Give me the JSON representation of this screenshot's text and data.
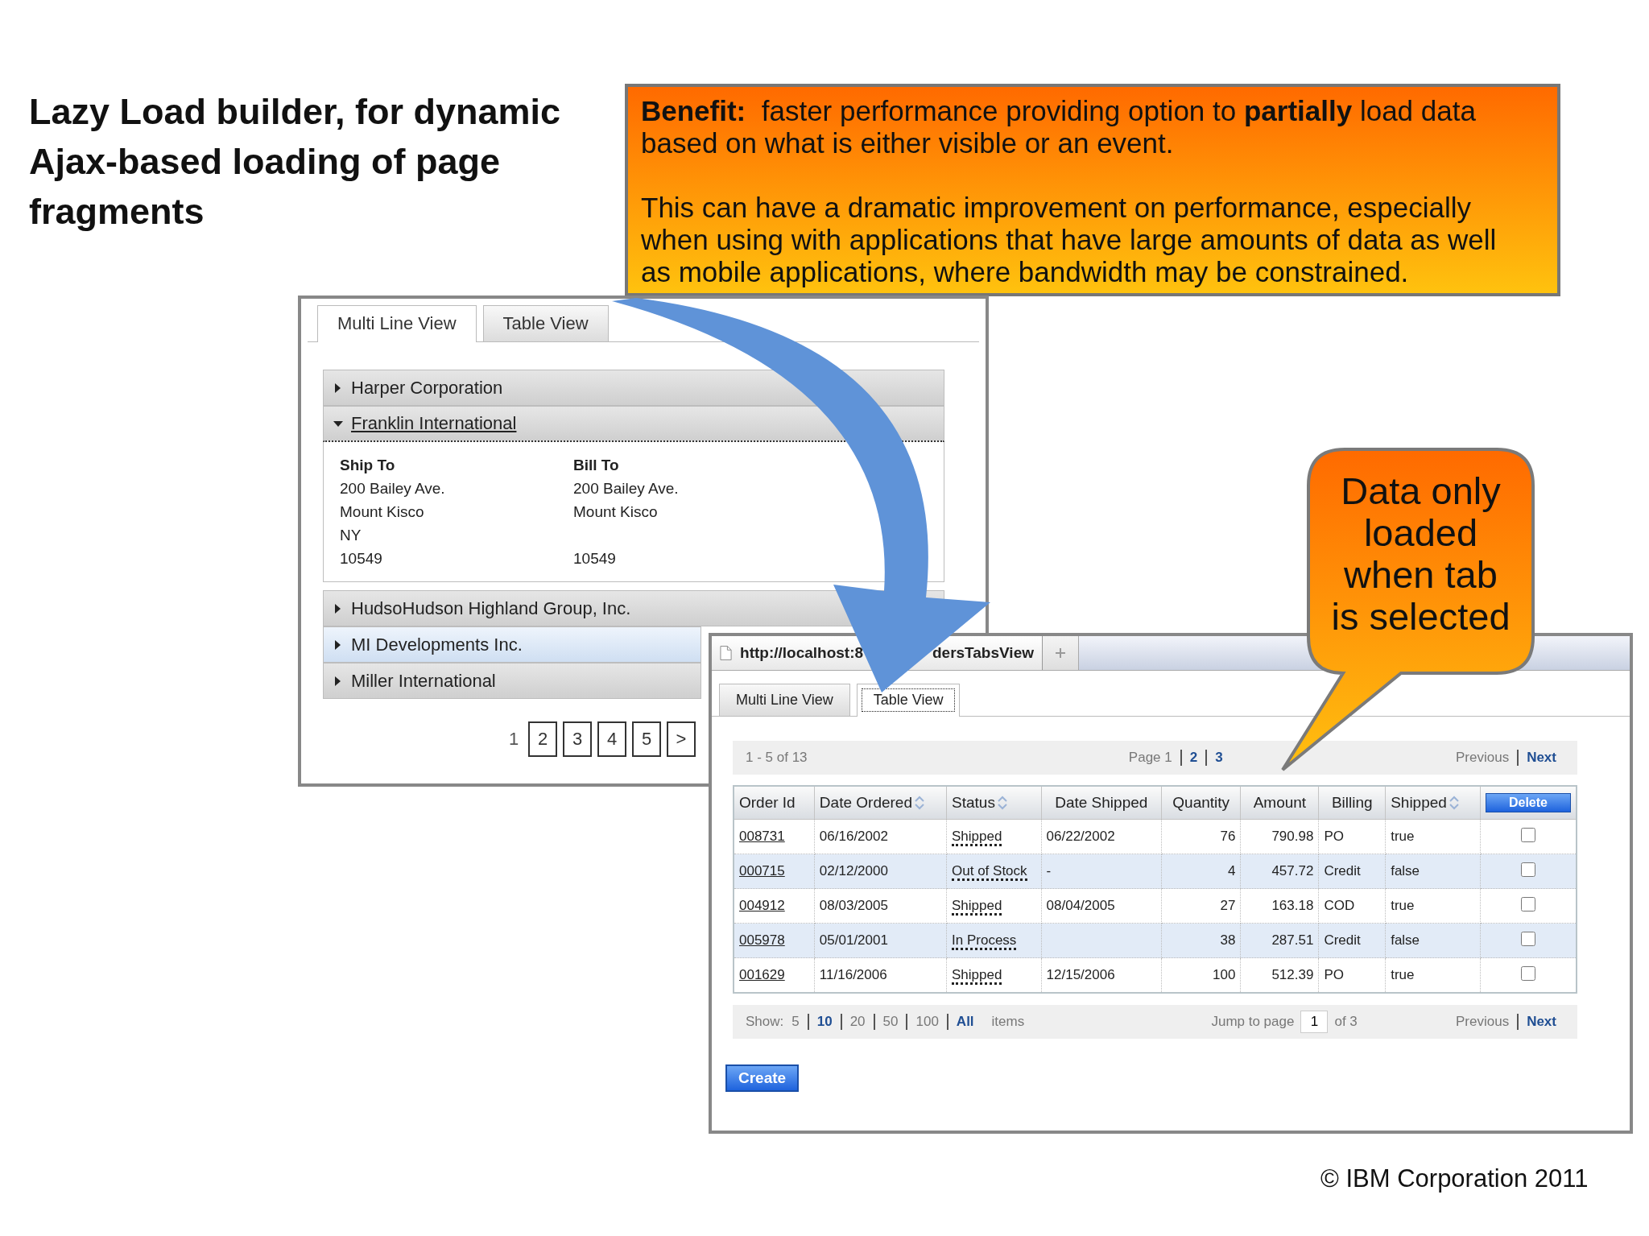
{
  "slide_title": "Lazy Load builder, for dynamic Ajax-based loading of page fragments",
  "benefit_box": {
    "paragraphs": [
      "**Benefit:**  faster performance providing option to **partially** load data based on what is either visible or an event.",
      "This can have a dramatic improvement on performance, especially when using with applications that have large amounts of data as well as mobile applications, where bandwidth may be constrained."
    ]
  },
  "multi_line_window": {
    "tabs": [
      {
        "label": "Multi Line View",
        "selected": true
      },
      {
        "label": "Table View",
        "selected": false
      }
    ],
    "accordion": [
      {
        "title": "Harper Corporation",
        "expanded": false,
        "hovered": false
      },
      {
        "title": "Franklin International",
        "expanded": true,
        "hovered": false,
        "details": {
          "headings": [
            "Ship To",
            "Bill To"
          ],
          "rows": [
            {
              "ship": "200 Bailey Ave.",
              "bill": "200 Bailey Ave."
            },
            {
              "ship": "Mount Kisco",
              "bill": "Mount Kisco"
            },
            {
              "ship": "NY"
            },
            {
              "ship": "10549",
              "bill": "10549"
            }
          ]
        }
      },
      {
        "title": "HudsoHudson Highland Group, Inc.",
        "expanded": false,
        "hovered": false
      },
      {
        "title": "MI Developments Inc.",
        "expanded": false,
        "hovered": true
      },
      {
        "title": "Miller International",
        "expanded": false,
        "hovered": false
      }
    ],
    "pagination": [
      {
        "label": "1",
        "selected": true
      },
      {
        "label": "2",
        "selected": false
      },
      {
        "label": "3",
        "selected": false
      },
      {
        "label": "4",
        "selected": false
      },
      {
        "label": "5",
        "selected": false
      },
      {
        "label": ">",
        "selected": false
      }
    ]
  },
  "table_window": {
    "browser_tab": {
      "url_start": "http://localhost:8",
      "url_end": "dersTabsView"
    },
    "tabs": [
      {
        "label": "Multi Line View",
        "selected": false
      },
      {
        "label": "Table View",
        "selected": true
      }
    ],
    "top_pager": {
      "range": "1 - 5 of 13",
      "pages": [
        {
          "label": "Page 1",
          "enabled": false
        },
        {
          "label": "2",
          "enabled": true
        },
        {
          "label": "3",
          "enabled": true
        }
      ],
      "nav": [
        {
          "label": "Previous",
          "enabled": false
        },
        {
          "label": "Next",
          "enabled": true
        }
      ]
    },
    "table": {
      "columns": [
        {
          "label": "Order Id",
          "sortable": false
        },
        {
          "label": "Date Ordered",
          "sortable": true
        },
        {
          "label": "Status",
          "sortable": true
        },
        {
          "label": "Date Shipped",
          "sortable": false
        },
        {
          "label": "Quantity",
          "sortable": false
        },
        {
          "label": "Amount",
          "sortable": false
        },
        {
          "label": "Billing",
          "sortable": false
        },
        {
          "label": "Shipped",
          "sortable": true
        }
      ],
      "delete_label": "Delete",
      "rows": [
        {
          "order_id": "008731",
          "date_ordered": "06/16/2002",
          "status": "Shipped",
          "date_shipped": "06/22/2002",
          "quantity": "76",
          "amount": "790.98",
          "billing": "PO",
          "shipped": "true",
          "checked": false
        },
        {
          "order_id": "000715",
          "date_ordered": "02/12/2000",
          "status": "Out of Stock",
          "date_shipped": "-",
          "quantity": "4",
          "amount": "457.72",
          "billing": "Credit",
          "shipped": "false",
          "checked": false
        },
        {
          "order_id": "004912",
          "date_ordered": "08/03/2005",
          "status": "Shipped",
          "date_shipped": "08/04/2005",
          "quantity": "27",
          "amount": "163.18",
          "billing": "COD",
          "shipped": "true",
          "checked": false
        },
        {
          "order_id": "005978",
          "date_ordered": "05/01/2001",
          "status": "In Process",
          "quantity": "38",
          "amount": "287.51",
          "billing": "Credit",
          "shipped": "false",
          "checked": false
        },
        {
          "order_id": "001629",
          "date_ordered": "11/16/2006",
          "status": "Shipped",
          "date_shipped": "12/15/2006",
          "quantity": "100",
          "amount": "512.39",
          "billing": "PO",
          "shipped": "true",
          "checked": false
        }
      ]
    },
    "footer": {
      "show_label": "Show:",
      "sizes": [
        {
          "label": "5",
          "enabled": false
        },
        {
          "label": "10",
          "enabled": true
        },
        {
          "label": "20",
          "enabled": false
        },
        {
          "label": "50",
          "enabled": false
        },
        {
          "label": "100",
          "enabled": false
        },
        {
          "label": "All",
          "enabled": true
        }
      ],
      "items_label": "items",
      "jump_label": "Jump to page",
      "jump_value": "1",
      "of_pages": "of 3",
      "nav": [
        {
          "label": "Previous",
          "enabled": false
        },
        {
          "label": "Next",
          "enabled": true
        }
      ]
    },
    "create_label": "Create"
  },
  "callout": {
    "lines": [
      "Data only",
      "loaded",
      "when tab",
      "is selected"
    ]
  },
  "copyright": "© IBM Corporation 2011"
}
